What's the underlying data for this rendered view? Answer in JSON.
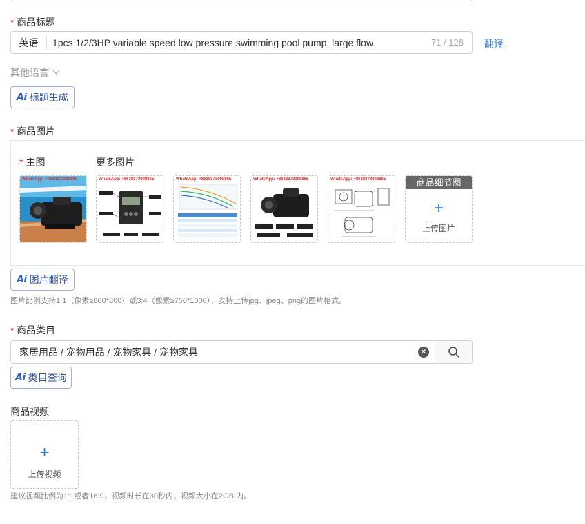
{
  "title_section": {
    "required_mark": "*",
    "label": "商品标题",
    "lang_prefix": "英语",
    "value": "1pcs 1/2/3HP variable speed low pressure swimming pool pump, large flow",
    "char_count": "71 / 128",
    "translate_label": "翻译",
    "other_lang_label": "其他语言",
    "ai_button": {
      "ai": "Ai",
      "label": "标题生成"
    }
  },
  "images_section": {
    "required_mark": "*",
    "label": "商品图片",
    "main_label": "主图",
    "more_label": "更多图片",
    "watermark": "WhatsApp: +8618373098865",
    "detail_header": "商品细节图",
    "upload_label": "上传图片",
    "ai_button": {
      "ai": "Ai",
      "label": "图片翻译"
    },
    "hint": "图片比例支持1:1（像素≥800*800）或3:4（像素≥750*1000），支持上传jpg、jpeg、png的图片格式。"
  },
  "category_section": {
    "required_mark": "*",
    "label": "商品类目",
    "value": "家居用品 / 宠物用品 / 宠物家具 / 宠物家具",
    "ai_button": {
      "ai": "Ai",
      "label": "类目查询"
    }
  },
  "video_section": {
    "label": "商品视频",
    "upload_label": "上传视频",
    "hint": "建议视频比例为1:1或者16:9，视频时长在30秒内，视频大小在2GB 内。"
  },
  "colors": {
    "accent": "#2f7bd6",
    "required": "#e33333",
    "ai": "#3262c8"
  }
}
